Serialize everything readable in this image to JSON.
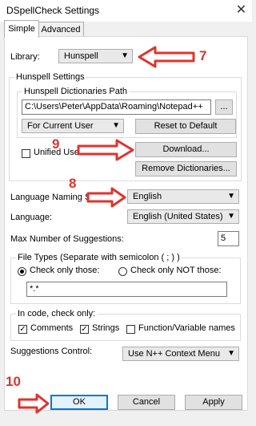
{
  "window": {
    "title": "DSpellCheck Settings",
    "close_glyph": "✕"
  },
  "tabs": [
    {
      "label": "Simple"
    },
    {
      "label": "Advanced"
    }
  ],
  "library": {
    "label": "Library:",
    "value": "Hunspell"
  },
  "hunspell_settings": {
    "group_title": "Hunspell Settings",
    "dictionaries_group_title": "Hunspell Dictionaries Path",
    "path_value": "C:\\Users\\Peter\\AppData\\Roaming\\Notepad++",
    "browse_label": "...",
    "user_scope_value": "For Current User",
    "reset_label": "Reset to Default",
    "unified_label": "Unified User Dictionary",
    "download_label": "Download...",
    "remove_label": "Remove Dictionaries..."
  },
  "language_naming": {
    "label": "Language Naming Style:",
    "value": "English"
  },
  "language": {
    "label": "Language:",
    "value": "English (United States)"
  },
  "max_suggestions": {
    "label": "Max Number of Suggestions:",
    "value": "5"
  },
  "file_types": {
    "group_title": "File Types (Separate with semicolon ( ; ) )",
    "check_only_label": "Check only those:",
    "check_not_label": "Check only NOT those:",
    "value": "*.*"
  },
  "in_code": {
    "group_title": "In code, check only:",
    "comments_label": "Comments",
    "strings_label": "Strings",
    "functions_label": "Function/Variable names"
  },
  "suggestions_control": {
    "label": "Suggestions Control:",
    "value": "Use N++ Context Menu"
  },
  "buttons": {
    "ok": "OK",
    "cancel": "Cancel",
    "apply": "Apply"
  },
  "annotations": {
    "seven": "7",
    "eight": "8",
    "nine": "9",
    "ten": "10",
    "color": "#e0332d"
  }
}
